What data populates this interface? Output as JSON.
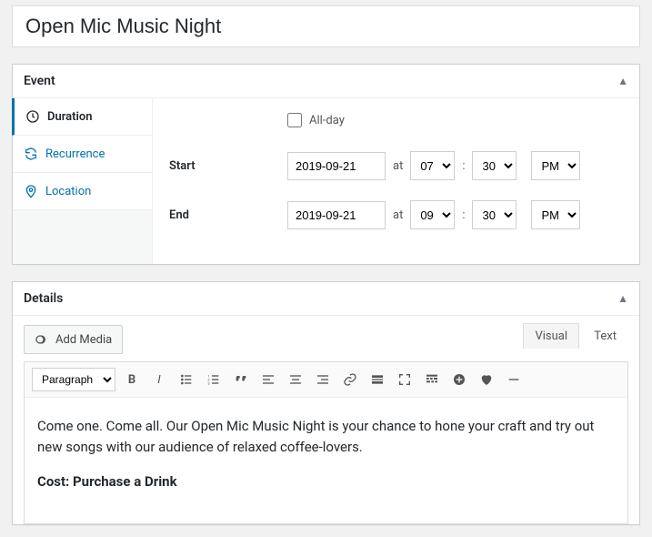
{
  "title": "Open Mic Music Night",
  "event": {
    "panel_title": "Event",
    "tabs": {
      "duration": "Duration",
      "recurrence": "Recurrence",
      "location": "Location"
    },
    "allday_label": "All-day",
    "start_label": "Start",
    "end_label": "End",
    "at_label": "at",
    "start": {
      "date": "2019-09-21",
      "hour": "07",
      "minute": "30",
      "meridiem": "PM"
    },
    "end": {
      "date": "2019-09-21",
      "hour": "09",
      "minute": "30",
      "meridiem": "PM"
    }
  },
  "details": {
    "panel_title": "Details",
    "add_media_label": "Add Media",
    "tabs": {
      "visual": "Visual",
      "text": "Text"
    },
    "format": "Paragraph",
    "body_line1": "Come one. Come all.  Our Open Mic Music Night is your chance to hone your craft and try out new songs with our audience of relaxed coffee-lovers.",
    "cost_label": "Cost: Purchase a Drink"
  }
}
